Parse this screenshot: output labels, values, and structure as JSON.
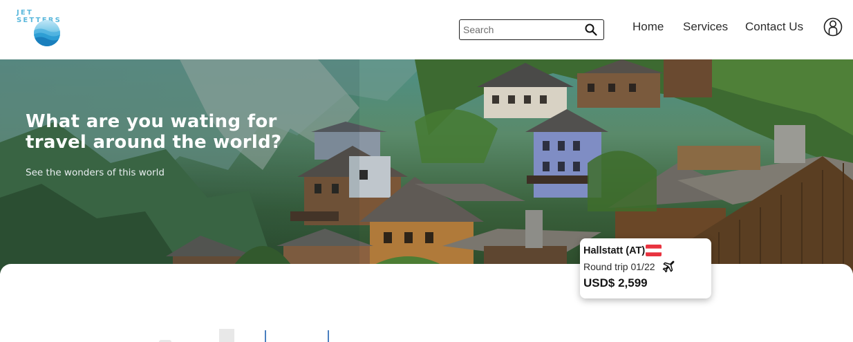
{
  "brand": {
    "name": "JET SETTERS",
    "logo_icon": "wave-globe-icon",
    "accent": "#5bb8dc"
  },
  "search": {
    "placeholder": "Search",
    "value": "",
    "icon": "search-icon"
  },
  "nav": [
    {
      "label": "Home"
    },
    {
      "label": "Services"
    },
    {
      "label": "Contact Us"
    }
  ],
  "profile": {
    "icon": "user-profile-icon"
  },
  "hero": {
    "title": "What are you wating for travel around the world?",
    "subtitle": "See the wonders of this world",
    "image": "alpine-village-hillside-photo"
  },
  "deal": {
    "destination": "Hallstatt (AT)",
    "flag": "austria-flag-icon",
    "trip": "Round trip 01/22",
    "trip_icon": "airplane-icon",
    "price": "USD$ 2,599"
  }
}
